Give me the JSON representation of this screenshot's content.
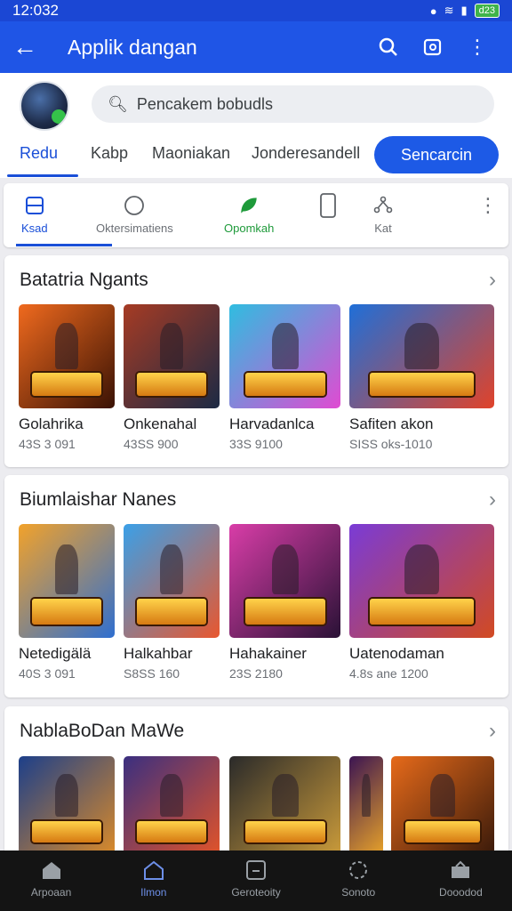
{
  "status": {
    "time": "12:032",
    "battery": "d23"
  },
  "app_bar": {
    "title": "Applik dangan",
    "back_icon": "arrow-back-icon",
    "actions": [
      "search-icon",
      "edit-icon",
      "more-vert-icon"
    ]
  },
  "profile": {
    "avatar": "avatar"
  },
  "search": {
    "placeholder": "Pencakem bobudls"
  },
  "tabs": [
    {
      "label": "Redu",
      "active": true
    },
    {
      "label": "Kabp",
      "active": false
    },
    {
      "label": "Maoniakan",
      "active": false
    },
    {
      "label": "Jonderesandell",
      "active": false
    }
  ],
  "primary_button": {
    "label": "Sencarcin"
  },
  "chips": [
    {
      "label": "Ksad",
      "icon": "square-icon",
      "selected": true
    },
    {
      "label": "Oktersimatiens",
      "icon": "circle-icon",
      "selected": false
    },
    {
      "label": "Opomkah",
      "icon": "leaf-icon",
      "selected": false,
      "color": "#1e9a3a"
    },
    {
      "label": "",
      "icon": "phone-icon",
      "selected": false
    },
    {
      "label": "Kat",
      "icon": "network-icon",
      "selected": false
    },
    {
      "label": "",
      "icon": "more-vert-icon",
      "selected": false
    }
  ],
  "sections": [
    {
      "title": "Batatria Ngants",
      "items": [
        {
          "name": "Golahrika",
          "meta": "43S 3 091",
          "colors": [
            "#f06a1e",
            "#3a1204"
          ]
        },
        {
          "name": "Onkenahal",
          "meta": "43SS 900",
          "colors": [
            "#a63b24",
            "#1c2a44"
          ]
        },
        {
          "name": "Harvadanlca",
          "meta": "33S 9100",
          "colors": [
            "#2fbde0",
            "#e04bd2"
          ]
        },
        {
          "name": "Safiten akon",
          "meta": "SISS oks-1010",
          "colors": [
            "#1f6fd8",
            "#e0432a"
          ]
        }
      ]
    },
    {
      "title": "Biumlaishar Nanes",
      "items": [
        {
          "name": "Netedigälä",
          "meta": "40S 3 091",
          "colors": [
            "#f2a22a",
            "#2f6fd0"
          ]
        },
        {
          "name": "Halkahbar",
          "meta": "S8SS 160",
          "colors": [
            "#3aa0e8",
            "#e8572f"
          ]
        },
        {
          "name": "Hahakainer",
          "meta": "23S 2180",
          "colors": [
            "#d93da8",
            "#2a1236"
          ]
        },
        {
          "name": "Uatenodaman",
          "meta": "4.8s ane 1200",
          "colors": [
            "#7a3bd6",
            "#d24a22"
          ]
        }
      ]
    },
    {
      "title": "NablaBoDan MaWe",
      "items": [
        {
          "name": "",
          "meta": "",
          "colors": [
            "#1c3f8a",
            "#d98a2a"
          ]
        },
        {
          "name": "",
          "meta": "",
          "colors": [
            "#3a2f80",
            "#e0532a"
          ]
        },
        {
          "name": "",
          "meta": "",
          "colors": [
            "#2a2a2a",
            "#c99a3a"
          ]
        },
        {
          "name": "",
          "meta": "",
          "colors": [
            "#3b1452",
            "#e6a12a"
          ]
        },
        {
          "name": "",
          "meta": "",
          "colors": [
            "#e66a1a",
            "#3a1a0a"
          ]
        }
      ]
    }
  ],
  "bottom_nav": [
    {
      "label": "Arpoaan",
      "icon": "home-icon",
      "active": false
    },
    {
      "label": "Ilmon",
      "icon": "house-outline-icon",
      "active": true
    },
    {
      "label": "Geroteoity",
      "icon": "box-icon",
      "active": false
    },
    {
      "label": "Sonoto",
      "icon": "gamepad-icon",
      "active": false
    },
    {
      "label": "Dooodod",
      "icon": "inbox-icon",
      "active": false
    }
  ]
}
